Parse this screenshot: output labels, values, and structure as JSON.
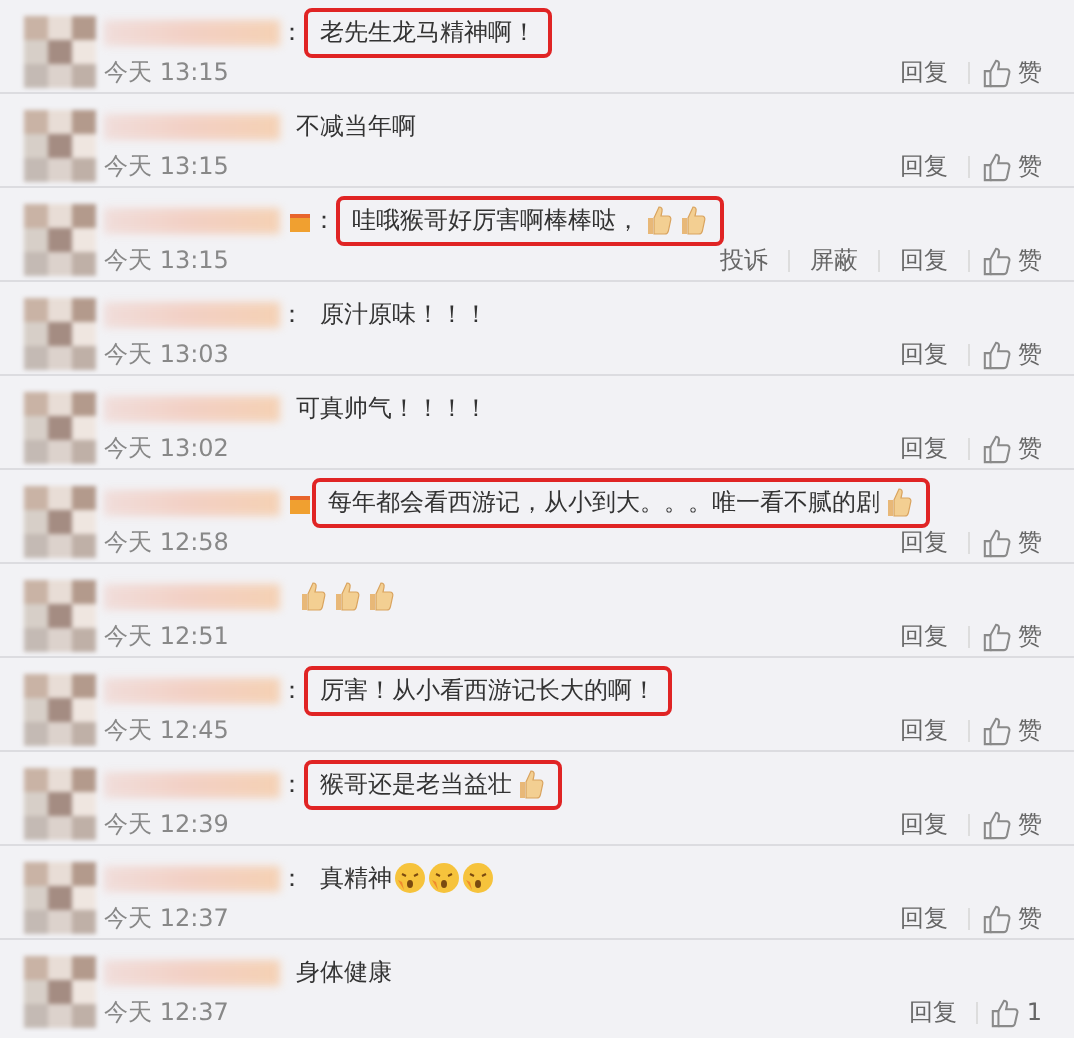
{
  "comments": [
    {
      "colon": "：",
      "content": [
        {
          "kind": "text",
          "text": "老先生龙马精神啊！"
        }
      ],
      "highlighted": true,
      "time": "今天 13:15",
      "actions": [
        "回复"
      ],
      "like": "赞"
    },
    {
      "content": [
        {
          "kind": "text",
          "text": "不减当年啊"
        }
      ],
      "highlighted": false,
      "time": "今天 13:15",
      "actions": [
        "回复"
      ],
      "like": "赞"
    },
    {
      "badge": true,
      "colon": "：",
      "content": [
        {
          "kind": "text",
          "text": "哇哦猴哥好厉害啊棒棒哒，"
        },
        {
          "kind": "thumb"
        },
        {
          "kind": "thumb"
        }
      ],
      "highlighted": true,
      "time": "今天 13:15",
      "actions": [
        "投诉",
        "屏蔽",
        "回复"
      ],
      "like": "赞"
    },
    {
      "colon": "：",
      "content": [
        {
          "kind": "text",
          "text": "原汁原味！！！"
        }
      ],
      "highlighted": false,
      "time": "今天 13:03",
      "actions": [
        "回复"
      ],
      "like": "赞"
    },
    {
      "content": [
        {
          "kind": "text",
          "text": "可真帅气！！！！"
        }
      ],
      "highlighted": false,
      "time": "今天 13:02",
      "actions": [
        "回复"
      ],
      "like": "赞"
    },
    {
      "badge": true,
      "content": [
        {
          "kind": "text",
          "text": "每年都会看西游记，从小到大。。。唯一看不腻的剧"
        },
        {
          "kind": "thumb"
        }
      ],
      "highlighted": true,
      "time": "今天 12:58",
      "actions": [
        "回复"
      ],
      "like": "赞"
    },
    {
      "content": [
        {
          "kind": "thumb"
        },
        {
          "kind": "thumb"
        },
        {
          "kind": "thumb"
        }
      ],
      "highlighted": false,
      "time": "今天 12:51",
      "actions": [
        "回复"
      ],
      "like": "赞"
    },
    {
      "colon": "：",
      "content": [
        {
          "kind": "text",
          "text": "厉害！从小看西游记长大的啊！"
        }
      ],
      "highlighted": true,
      "time": "今天 12:45",
      "actions": [
        "回复"
      ],
      "like": "赞"
    },
    {
      "colon": "：",
      "content": [
        {
          "kind": "text",
          "text": "猴哥还是老当益壮"
        },
        {
          "kind": "thumb"
        }
      ],
      "highlighted": true,
      "time": "今天 12:39",
      "actions": [
        "回复"
      ],
      "like": "赞"
    },
    {
      "colon": "：",
      "content": [
        {
          "kind": "text",
          "text": "真精神"
        },
        {
          "kind": "face"
        },
        {
          "kind": "face"
        },
        {
          "kind": "face"
        }
      ],
      "highlighted": false,
      "time": "今天 12:37",
      "actions": [
        "回复"
      ],
      "like": "赞"
    },
    {
      "content": [
        {
          "kind": "text",
          "text": "身体健康"
        }
      ],
      "highlighted": false,
      "time": "今天 12:37",
      "actions": [
        "回复"
      ],
      "like": "1"
    }
  ]
}
